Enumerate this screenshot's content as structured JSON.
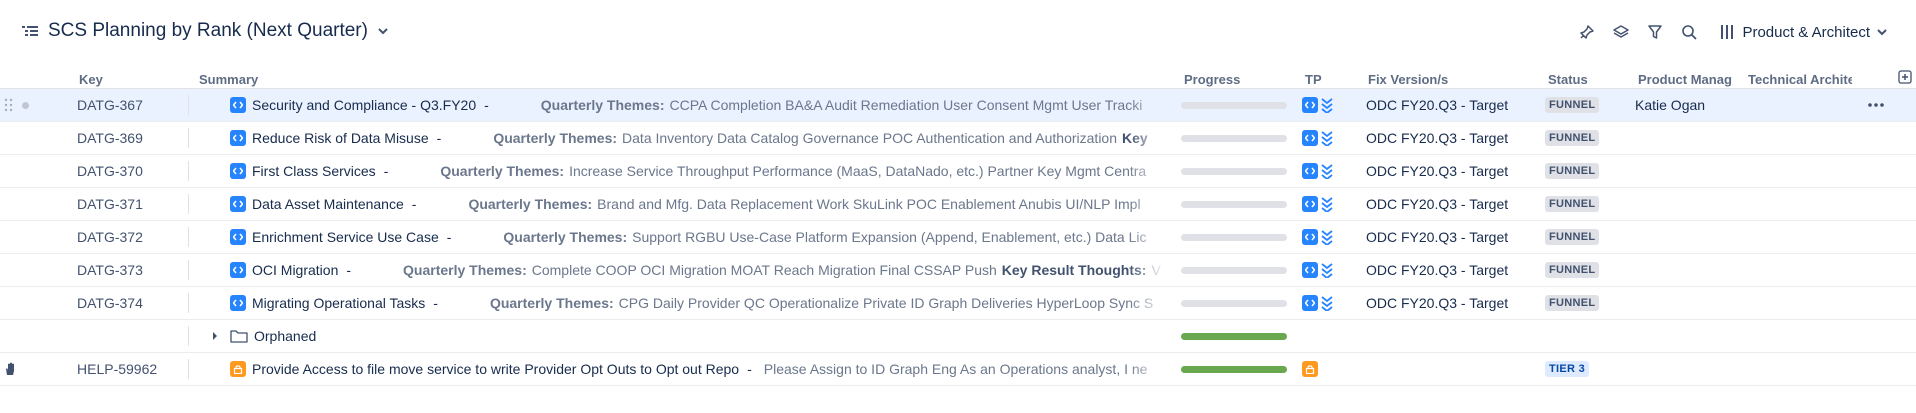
{
  "board": {
    "title": "SCS Planning by Rank (Next Quarter)"
  },
  "toolbar": {
    "view_label": "Product & Architect"
  },
  "columns": {
    "key": "Key",
    "summary": "Summary",
    "progress": "Progress",
    "tp": "TP",
    "fix_version": "Fix Version/s",
    "status": "Status",
    "product_manager": "Product Manag",
    "technical_architect": "Technical Archite"
  },
  "rows": [
    {
      "key": "DATG-367",
      "name": "Security and Compliance - Q3.FY20",
      "sep": "-",
      "themes_label": "Quarterly Themes:",
      "themes": "CCPA Completion BA&A Audit Remediation User Consent Mgmt User Tracki",
      "fix_version": "ODC FY20.Q3 - Target",
      "status": "FUNNEL",
      "product_manager": "Katie Ogan",
      "progress": 0
    },
    {
      "key": "DATG-369",
      "name": "Reduce Risk of Data Misuse",
      "sep": "-",
      "themes_label": "Quarterly Themes:",
      "themes": "Data Inventory Data Catalog Governance POC Authentication and Authorization",
      "extra_label": "Key",
      "fix_version": "ODC FY20.Q3 - Target",
      "status": "FUNNEL",
      "progress": 0
    },
    {
      "key": "DATG-370",
      "name": "First Class Services",
      "sep": "-",
      "themes_label": "Quarterly Themes:",
      "themes": "Increase Service Throughput Performance (MaaS, DataNado, etc.) Partner Key Mgmt Centra",
      "fix_version": "ODC FY20.Q3 - Target",
      "status": "FUNNEL",
      "progress": 0
    },
    {
      "key": "DATG-371",
      "name": "Data Asset Maintenance",
      "sep": "-",
      "themes_label": "Quarterly Themes:",
      "themes": "Brand and Mfg. Data Replacement Work SkuLink POC Enablement Anubis UI/NLP Impl",
      "fix_version": "ODC FY20.Q3 - Target",
      "status": "FUNNEL",
      "progress": 0
    },
    {
      "key": "DATG-372",
      "name": "Enrichment Service Use Case",
      "sep": "-",
      "themes_label": "Quarterly Themes:",
      "themes": "Support RGBU Use-Case Platform Expansion (Append, Enablement, etc.) Data Lic",
      "fix_version": "ODC FY20.Q3 - Target",
      "status": "FUNNEL",
      "progress": 0
    },
    {
      "key": "DATG-373",
      "name": "OCI Migration",
      "sep": "-",
      "themes_label": "Quarterly Themes:",
      "themes": "Complete COOP OCI Migration MOAT Reach Migration Final CSSAP Push",
      "extra_label": "Key Result Thoughts:",
      "extra_text": "V",
      "fix_version": "ODC FY20.Q3 - Target",
      "status": "FUNNEL",
      "progress": 0
    },
    {
      "key": "DATG-374",
      "name": "Migrating Operational Tasks",
      "sep": "-",
      "themes_label": "Quarterly Themes:",
      "themes": "CPG Daily Provider QC Operationalize Private ID Graph Deliveries HyperLoop Sync S",
      "fix_version": "ODC FY20.Q3 - Target",
      "status": "FUNNEL",
      "progress": 0
    }
  ],
  "orphaned": {
    "name": "Orphaned",
    "progress": 1
  },
  "help_row": {
    "key": "HELP-59962",
    "name": "Provide Access to file move service to write Provider Opt Outs to Opt out Repo",
    "sep": "-",
    "description": "Please Assign to ID Graph Eng As an Operations analyst, I ne",
    "status": "TIER 3",
    "progress": 1
  },
  "icons": {
    "title": "list-hierarchy-icon",
    "pin": "pin-icon",
    "layers": "layers-icon",
    "filter": "filter-icon",
    "search": "search-icon",
    "columns": "columns-icon",
    "epic": "epic-icon",
    "rank": "rank-icon",
    "task": "lock-task-icon"
  },
  "colors": {
    "epic": "#2684ff",
    "task": "#ff991f",
    "progress_done": "#6aa84f",
    "selected_row": "#ebf2ff"
  }
}
